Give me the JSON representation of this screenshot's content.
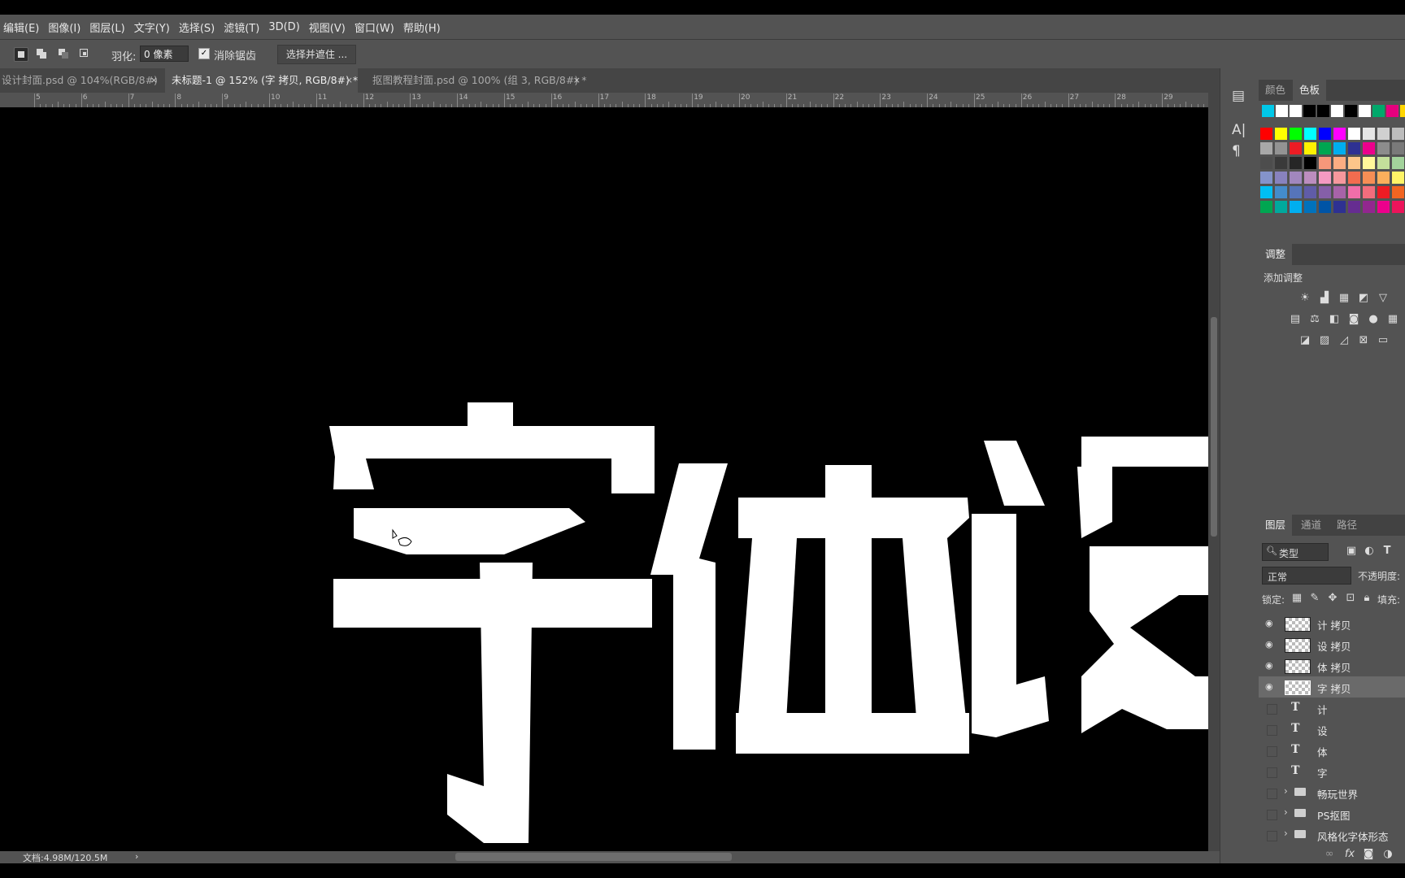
{
  "menu": [
    "编辑(E)",
    "图像(I)",
    "图层(L)",
    "文字(Y)",
    "选择(S)",
    "滤镜(T)",
    "3D(D)",
    "视图(V)",
    "窗口(W)",
    "帮助(H)"
  ],
  "options": {
    "feather_label": "羽化:",
    "feather_value": "0 像素",
    "antialias_label": "消除锯齿",
    "antialias_checked": "✓",
    "select_mask_label": "选择并遮住 ..."
  },
  "tabs": [
    {
      "label": "设计封面.psd @ 104%(RGB/8#)",
      "active": false
    },
    {
      "label": "未标题-1 @ 152% (字 拷贝, RGB/8#) *",
      "active": true
    },
    {
      "label": "抠图教程封面.psd @ 100% (组 3, RGB/8#) *",
      "active": false
    }
  ],
  "tab_close_glyph": "×",
  "ruler_numbers": [
    "5",
    "6",
    "7",
    "8",
    "9",
    "10",
    "11",
    "12",
    "13",
    "14",
    "15",
    "16",
    "17",
    "18",
    "19",
    "20",
    "21",
    "22",
    "23",
    "24",
    "25",
    "26",
    "27",
    "28",
    "29"
  ],
  "status": {
    "doc": "文档:4.98M/120.5M",
    "arrow": "›"
  },
  "panels": {
    "color_tabs": [
      "颜色",
      "色板"
    ],
    "adjust_tab": "调整",
    "add_adjust": "添加调整",
    "layer_tabs": [
      "图层",
      "通道",
      "路径"
    ],
    "filter_kind": "类型",
    "blend_mode": "正常",
    "opacity_label": "不透明度:",
    "lock_label": "锁定:",
    "fill_label": "填充:"
  },
  "layers": [
    {
      "name": "计 拷贝",
      "kind": "raster",
      "visible": true,
      "selected": false
    },
    {
      "name": "设 拷贝",
      "kind": "raster",
      "visible": true,
      "selected": false
    },
    {
      "name": "体 拷贝",
      "kind": "raster",
      "visible": true,
      "selected": false
    },
    {
      "name": "字 拷贝",
      "kind": "raster",
      "visible": true,
      "selected": true
    },
    {
      "name": "计",
      "kind": "text",
      "visible": false,
      "selected": false
    },
    {
      "name": "设",
      "kind": "text",
      "visible": false,
      "selected": false
    },
    {
      "name": "体",
      "kind": "text",
      "visible": false,
      "selected": false
    },
    {
      "name": "字",
      "kind": "text",
      "visible": false,
      "selected": false
    },
    {
      "name": "畅玩世界",
      "kind": "group",
      "visible": false,
      "selected": false
    },
    {
      "name": "PS抠图",
      "kind": "group",
      "visible": false,
      "selected": false
    },
    {
      "name": "风格化字体形态",
      "kind": "group",
      "visible": false,
      "selected": false
    }
  ],
  "icons": {
    "eye": "👁",
    "text_layer": "T",
    "chevron": "›",
    "fx": "fx"
  },
  "swatch_colors": {
    "recent": [
      "#00c8e8",
      "#ffffff",
      "#ffffff",
      "#000000",
      "#000000",
      "#ffffff",
      "#000000",
      "#ffffff",
      "#00a86b",
      "#e6007e",
      "#ffd500"
    ],
    "grid": [
      [
        "#ff0000",
        "#ffff00",
        "#00ff00",
        "#00ffff",
        "#0000ff",
        "#ff00ff",
        "#ffffff",
        "#e6e6e6",
        "#d0d0d0",
        "#bdbdbd"
      ],
      [
        "#a8a8a8",
        "#939393",
        "#ed1c24",
        "#fff200",
        "#00a651",
        "#00aeef",
        "#2e3192",
        "#ec008c",
        "#8c8c8c",
        "#7a7a7a"
      ],
      [
        "#4d4d4d",
        "#3a3a3a",
        "#262626",
        "#000000",
        "#f7977a",
        "#fbad82",
        "#fdc68a",
        "#fff79a",
        "#c4df9b",
        "#a3d39c"
      ],
      [
        "#8493ca",
        "#8882be",
        "#a187be",
        "#bc8dbf",
        "#f49ac2",
        "#f6989d",
        "#f26c4f",
        "#f68e55",
        "#fbaf5c",
        "#fff467"
      ],
      [
        "#00bff3",
        "#448ccb",
        "#5674b9",
        "#605ca8",
        "#855fa8",
        "#a763a8",
        "#f06ea9",
        "#f26d7d",
        "#ed1c24",
        "#f26522"
      ],
      [
        "#00a651",
        "#00a99d",
        "#00aeef",
        "#0072bc",
        "#0054a6",
        "#2e3192",
        "#662d91",
        "#92278f",
        "#ec008c",
        "#ed145b"
      ]
    ]
  }
}
